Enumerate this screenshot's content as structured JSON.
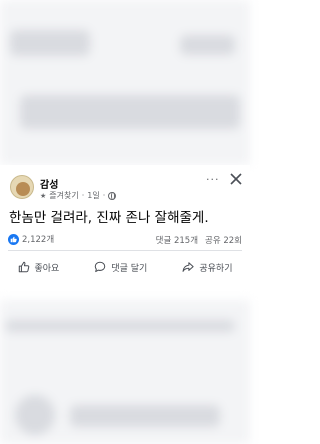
{
  "post": {
    "author": "감성",
    "favorite_label": "즐겨찾기",
    "separator": "·",
    "time": "1일",
    "text": "한놈만 걸려라, 진짜 존나 잘해줄게.",
    "more_label": "···",
    "reaction_count": "2,122개",
    "comments_count": "댓글 215개",
    "shares_count": "공유 22회"
  },
  "actions": {
    "like_label": "좋아요",
    "comment_label": "댓글 달기",
    "share_label": "공유하기"
  },
  "colors": {
    "accent": "#1877f2",
    "text_primary": "#050505",
    "text_secondary": "#65676b"
  }
}
